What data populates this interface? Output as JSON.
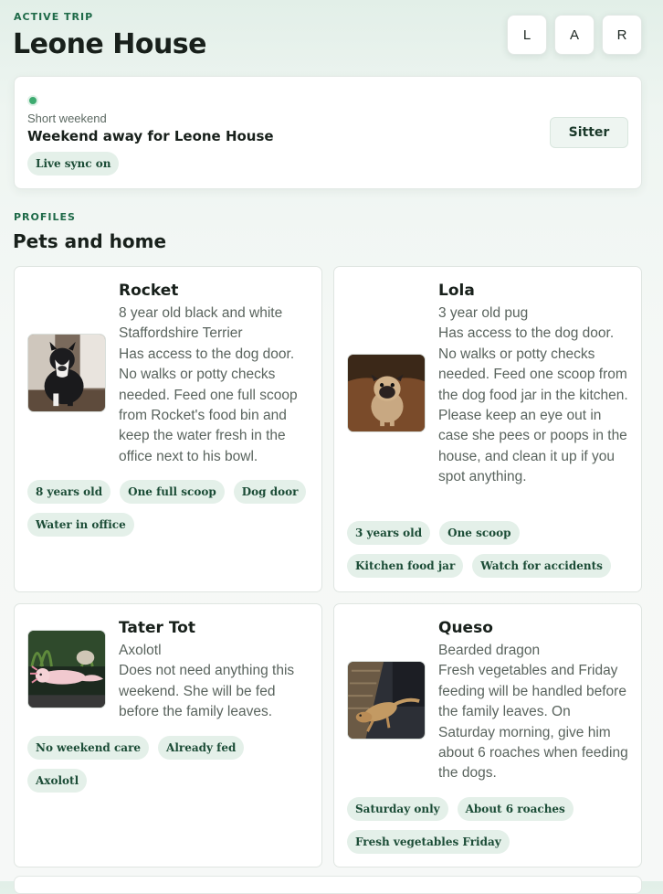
{
  "header": {
    "eyebrow": "ACTIVE TRIP",
    "title": "Leone House",
    "buttons": [
      "L",
      "A",
      "R"
    ]
  },
  "trip": {
    "status_color": "#3dab70",
    "kind": "Short weekend",
    "name": "Weekend away for Leone House",
    "sync_badge": "Live sync on",
    "sitter_label": "Sitter"
  },
  "profiles": {
    "eyebrow": "PROFILES",
    "title": "Pets and home",
    "pets": [
      {
        "name": "Rocket",
        "species": "8 year old black and white Staffordshire Terrier",
        "notes": "Has access to the dog door. No walks or potty checks needed. Feed one full scoop from Rocket's food bin and keep the water fresh in the office next to his bowl.",
        "tags": [
          "8 years old",
          "One full scoop",
          "Dog door",
          "Water in office"
        ]
      },
      {
        "name": "Lola",
        "species": "3 year old pug",
        "notes": "Has access to the dog door. No walks or potty checks needed. Feed one scoop from the dog food jar in the kitchen. Please keep an eye out in case she pees or poops in the house, and clean it up if you spot anything.",
        "tags": [
          "3 years old",
          "One scoop",
          "Kitchen food jar",
          "Watch for accidents"
        ]
      },
      {
        "name": "Tater Tot",
        "species": "Axolotl",
        "notes": "Does not need anything this weekend. She will be fed before the family leaves.",
        "tags": [
          "No weekend care",
          "Already fed",
          "Axolotl"
        ]
      },
      {
        "name": "Queso",
        "species": "Bearded dragon",
        "notes": "Fresh vegetables and Friday feeding will be handled before the family leaves. On Saturday morning, give him about 6 roaches when feeding the dogs.",
        "tags": [
          "Saturday only",
          "About 6 roaches",
          "Fresh vegetables Friday"
        ]
      }
    ]
  },
  "colors": {
    "accent": "#1e6a48",
    "pill_bg": "#e4f0e9",
    "pill_text": "#1b4c36"
  }
}
